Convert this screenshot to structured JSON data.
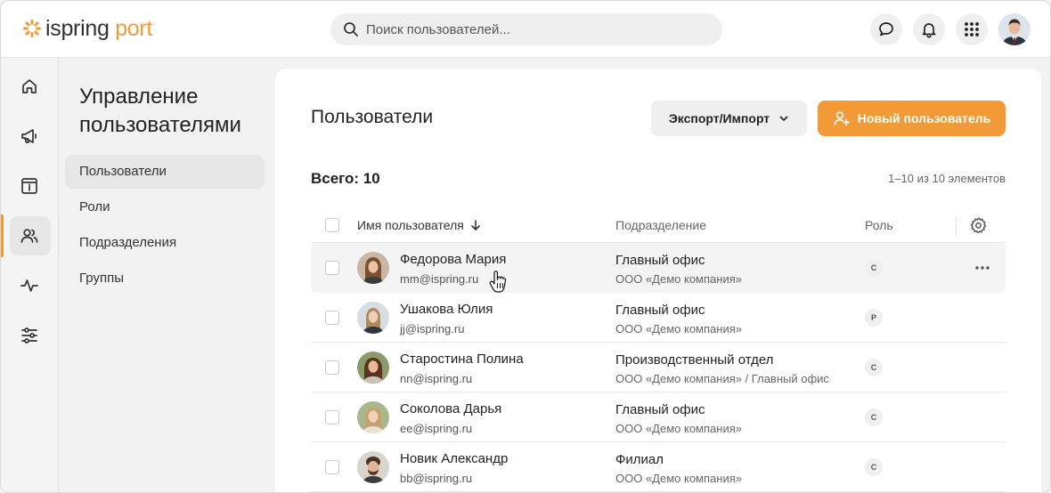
{
  "header": {
    "logo_main": "ispring",
    "logo_accent": "port",
    "search_placeholder": "Поиск пользователей..."
  },
  "rail": {
    "items": [
      {
        "icon": "home-icon"
      },
      {
        "icon": "megaphone-icon"
      },
      {
        "icon": "info-box-icon"
      },
      {
        "icon": "users-icon",
        "active": true
      },
      {
        "icon": "activity-icon"
      },
      {
        "icon": "sliders-icon"
      }
    ]
  },
  "section": {
    "title": "Управление пользователями",
    "items": [
      {
        "label": "Пользователи",
        "active": true
      },
      {
        "label": "Роли"
      },
      {
        "label": "Подразделения"
      },
      {
        "label": "Группы"
      }
    ]
  },
  "main": {
    "title": "Пользователи",
    "export_label": "Экспорт/Импорт",
    "new_user_label": "Новый пользователь",
    "total_label": "Всего: 10",
    "range_label": "1–10 из 10 элементов",
    "columns": {
      "name": "Имя пользователя",
      "dept": "Подразделение",
      "role": "Роль"
    },
    "rows": [
      {
        "name": "Федорова Мария",
        "email": "mm@ispring.ru",
        "dept": "Главный офис",
        "company": "ООО «Демо компания»",
        "role": "С"
      },
      {
        "name": "Ушакова Юлия",
        "email": "jj@ispring.ru",
        "dept": "Главный офис",
        "company": "ООО «Демо компания»",
        "role": "Р"
      },
      {
        "name": "Старостина Полина",
        "email": "nn@ispring.ru",
        "dept": "Производственный отдел",
        "company": "ООО «Демо компания» / Главный офис",
        "role": "С"
      },
      {
        "name": "Соколова Дарья",
        "email": "ee@ispring.ru",
        "dept": "Главный офис",
        "company": "ООО «Демо компания»",
        "role": "С"
      },
      {
        "name": "Новик Александр",
        "email": "bb@ispring.ru",
        "dept": "Филиал",
        "company": "ООО «Демо компания»",
        "role": "С"
      }
    ]
  },
  "colors": {
    "accent": "#f29a38",
    "surface": "#ffffff",
    "background": "#f2f2f2"
  }
}
